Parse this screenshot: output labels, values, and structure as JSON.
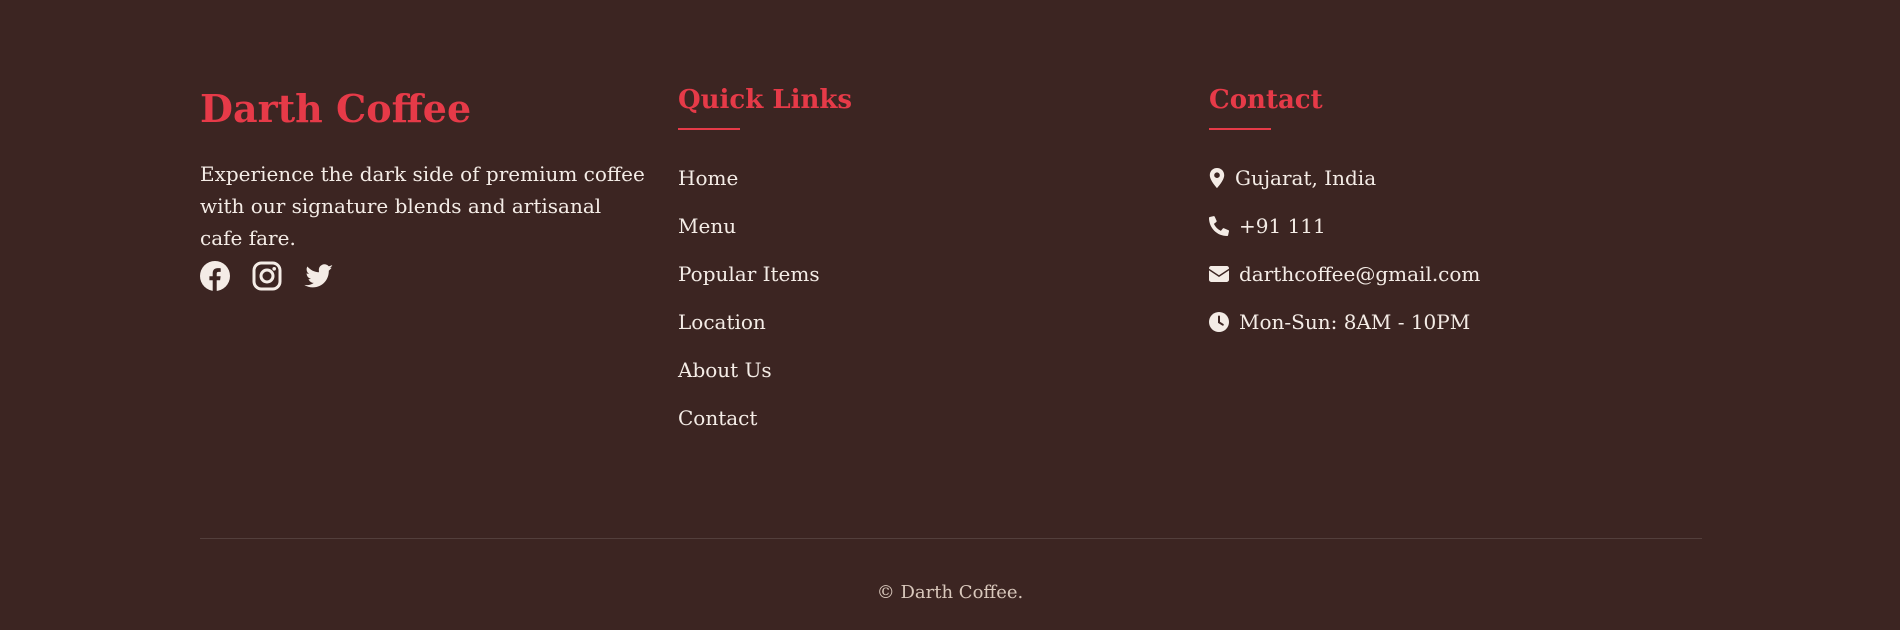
{
  "brand": {
    "title": "Darth Coffee",
    "description": "Experience the dark side of premium coffee with our signature blends and artisanal cafe fare."
  },
  "social": {
    "items": [
      {
        "name": "facebook-icon"
      },
      {
        "name": "instagram-icon"
      },
      {
        "name": "twitter-icon"
      }
    ]
  },
  "quick_links": {
    "title": "Quick Links",
    "items": [
      "Home",
      "Menu",
      "Popular Items",
      "Location",
      "About Us",
      "Contact"
    ]
  },
  "contact": {
    "title": "Contact",
    "items": [
      {
        "icon": "map-pin-icon",
        "text": "Gujarat, India"
      },
      {
        "icon": "phone-icon",
        "text": "+91 111"
      },
      {
        "icon": "mail-icon",
        "text": "darthcoffee@gmail.com"
      },
      {
        "icon": "clock-icon",
        "text": "Mon-Sun: 8AM - 10PM"
      }
    ]
  },
  "footer": {
    "copyright": "© Darth Coffee."
  },
  "colors": {
    "background": "#3c2522",
    "accent": "#e63a48",
    "text": "#f4ece6"
  }
}
